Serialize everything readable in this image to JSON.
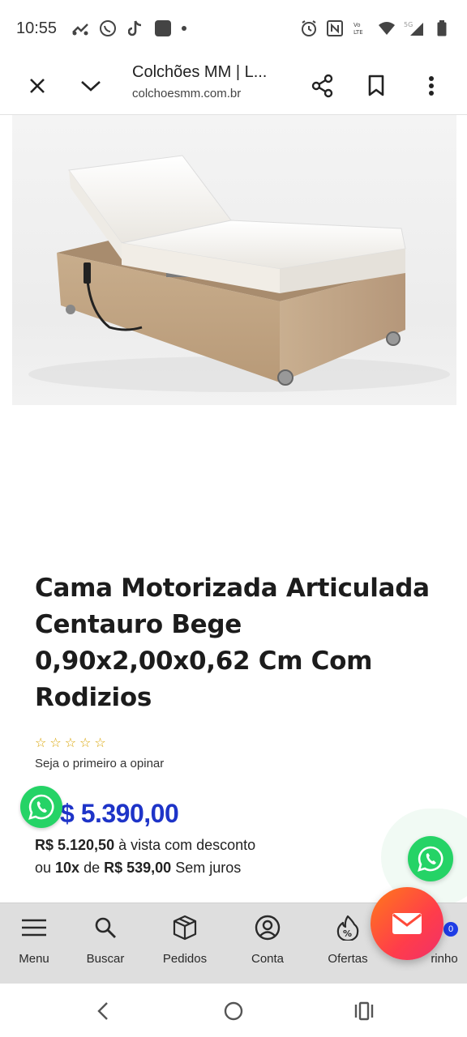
{
  "status_bar": {
    "time": "10:55",
    "network_label": "5G"
  },
  "browser": {
    "title": "Colchões MM | L...",
    "url": "colchoesmm.com.br"
  },
  "product": {
    "image_icon": "adjustable-bed-photo",
    "title": "Cama Motorizada Articulada Centauro Bege 0,90x2,00x0,62 Cm Com Rodizios",
    "rating_stars": 0,
    "rating_max": 5,
    "review_cta": "Seja o primeiro a opinar",
    "price": "$ 5.390,00",
    "cash_price": "R$ 5.120,50",
    "cash_suffix": " à vista com desconto",
    "installments_prefix": "ou ",
    "installments_count": "10x",
    "installments_mid": " de ",
    "installments_value": "R$ 539,00",
    "installments_suffix": " Sem juros"
  },
  "bottom_nav": {
    "items": [
      {
        "label": "Menu",
        "icon": "hamburger-icon"
      },
      {
        "label": "Buscar",
        "icon": "search-icon"
      },
      {
        "label": "Pedidos",
        "icon": "box-icon"
      },
      {
        "label": "Conta",
        "icon": "user-icon"
      },
      {
        "label": "Ofertas",
        "icon": "discount-icon"
      },
      {
        "label": "rinho",
        "icon": "cart-icon"
      }
    ],
    "cart_count": "0"
  },
  "colors": {
    "price_blue": "#1e34c8",
    "whatsapp_green": "#25d366",
    "fab_orange": "#ff5a2e",
    "nav_bg": "#dedede"
  }
}
